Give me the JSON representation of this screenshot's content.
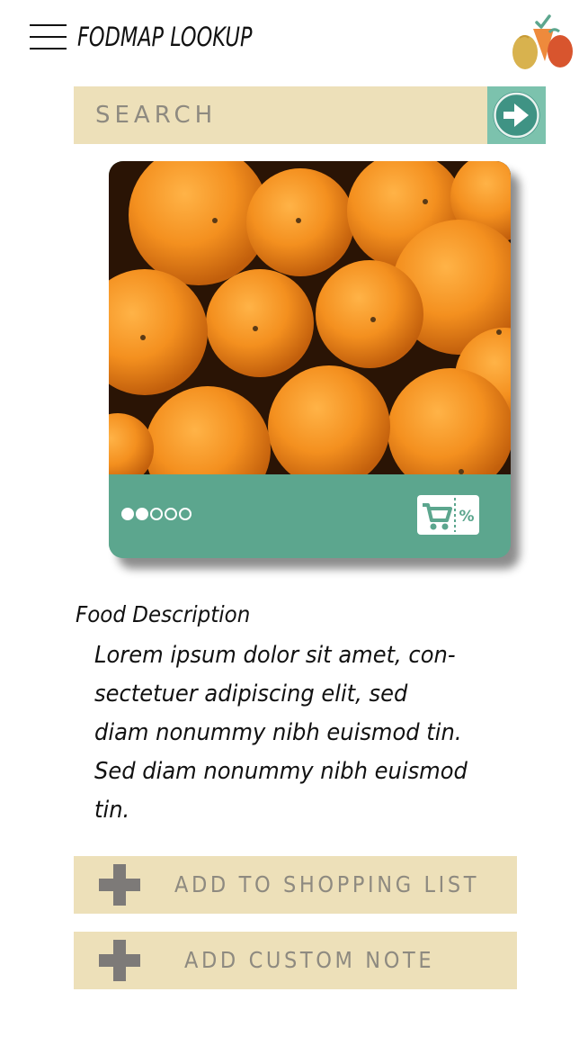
{
  "header": {
    "title": "FODMAP LOOKUP",
    "menu_icon": "hamburger-menu-icon",
    "logo_icon": "fruit-veggie-logo-icon"
  },
  "search": {
    "placeholder": "SEARCH",
    "value": "",
    "button_icon": "arrow-right-circle-icon"
  },
  "food_card": {
    "image": "mandarin-oranges-photo",
    "rating": {
      "filled": 2,
      "total": 5
    },
    "deal_icon": "cart-discount-coupon-icon"
  },
  "description": {
    "title": "Food Description",
    "lines": [
      "Lorem ipsum dolor sit amet, con-",
      "sectetuer adipiscing elit, sed",
      "diam nonummy nibh euismod tin.",
      "Sed diam nonummy nibh euismod",
      "tin."
    ]
  },
  "actions": {
    "add_to_shopping_list": "ADD TO SHOPPING LIST",
    "add_custom_note": "ADD CUSTOM NOTE"
  },
  "colors": {
    "search_bg": "#ede0b9",
    "accent_teal": "#5ca68e",
    "search_button": "#7cc2ad",
    "button_text": "#8e8a80"
  }
}
